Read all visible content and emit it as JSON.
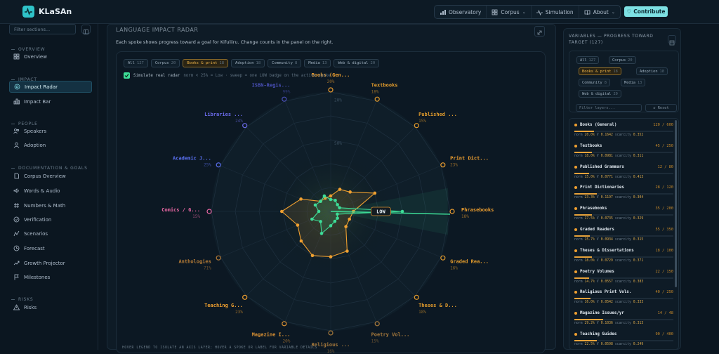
{
  "app": {
    "name": "KLaSAn"
  },
  "nav": {
    "items": [
      {
        "label": "Observatory",
        "icon": "chart-icon",
        "caret": false
      },
      {
        "label": "Corpus",
        "icon": "grid-icon",
        "caret": true
      },
      {
        "label": "Simulation",
        "icon": "pulse-icon",
        "caret": false
      },
      {
        "label": "About",
        "icon": "book-icon",
        "caret": true
      }
    ],
    "contribute": "Contribute"
  },
  "sidebar": {
    "filter_placeholder": "Filter sections...",
    "sections": [
      {
        "title": "OVERVIEW",
        "items": [
          {
            "label": "Overview",
            "icon": "grid-icon"
          }
        ]
      },
      {
        "title": "IMPACT",
        "items": [
          {
            "label": "Impact Radar",
            "icon": "radar-icon",
            "active": true
          },
          {
            "label": "Impact Bar",
            "icon": "bar-chart-icon"
          }
        ]
      },
      {
        "title": "PEOPLE",
        "items": [
          {
            "label": "Speakers",
            "icon": "users-icon"
          },
          {
            "label": "Adoption",
            "icon": "adoption-icon"
          }
        ]
      },
      {
        "title": "DOCUMENTATION & GOALS",
        "items": [
          {
            "label": "Corpus Overview",
            "icon": "document-icon"
          },
          {
            "label": "Words & Audio",
            "icon": "audio-icon"
          },
          {
            "label": "Numbers & Math",
            "icon": "hash-icon"
          },
          {
            "label": "Verification",
            "icon": "check-circle-icon"
          },
          {
            "label": "Scenarios",
            "icon": "scenarios-icon"
          },
          {
            "label": "Forecast",
            "icon": "forecast-icon"
          },
          {
            "label": "Growth Projector",
            "icon": "trend-icon"
          },
          {
            "label": "Milestones",
            "icon": "flag-icon"
          }
        ]
      },
      {
        "title": "RISKS",
        "items": [
          {
            "label": "Risks",
            "icon": "warning-icon"
          }
        ]
      }
    ]
  },
  "main": {
    "title": "LANGUAGE IMPACT RADAR",
    "subtitle": "Each spoke shows progress toward a goal for Kifuliiru. Change counts in the panel on the right.",
    "chips": [
      {
        "label": "All",
        "count": "127"
      },
      {
        "label": "Corpus",
        "count": "20"
      },
      {
        "label": "Books & print",
        "count": "18",
        "selected": true
      },
      {
        "label": "Adoption",
        "count": "18"
      },
      {
        "label": "Community",
        "count": "8"
      },
      {
        "label": "Media",
        "count": "13"
      },
      {
        "label": "Web & digital",
        "count": "20"
      }
    ],
    "simulate_label": "Simulate real radar",
    "simulate_note": "norm < 25% = Low · sweep = one LOW badge on the active spoke",
    "low_badge": "LOW",
    "footer_hint": "HOVER LEGEND TO ISOLATE AN AXIS LAYER; HOVER A SPOKE OR LABEL FOR VARIABLE DETAILS"
  },
  "chart_data": {
    "type": "radar",
    "spokes": [
      {
        "label": "Books (Gen...",
        "pct": "20%",
        "color": "#f0a030",
        "outer": 0.13,
        "inner": 0.1
      },
      {
        "label": "Textbooks",
        "pct": "18%",
        "color": "#e09a2c",
        "outer": 0.2,
        "inner": 0.1
      },
      {
        "label": "Published ...",
        "pct": "15%",
        "color": "#e09a2c",
        "outer": 0.23,
        "inner": 0.08
      },
      {
        "label": "Print Dict...",
        "pct": "23%",
        "color": "#f0a030",
        "outer": 0.4,
        "inner": 0.08
      },
      {
        "label": "Phrasebooks",
        "pct": "18%",
        "color": "#f0a030",
        "outer": 0.19,
        "inner": 0.6
      },
      {
        "label": "Graded Rea...",
        "pct": "16%",
        "color": "#e09a2c",
        "outer": 0.17,
        "inner": 0.06
      },
      {
        "label": "Theses & D...",
        "pct": "18%",
        "color": "#e09a2c",
        "outer": 0.18,
        "inner": 0.08
      },
      {
        "label": "Poetry Vol...",
        "pct": "15%",
        "color": "#a87a3c",
        "outer": 0.36,
        "inner": 0.09
      },
      {
        "label": "Religious ...",
        "pct": "16%",
        "color": "#a87a3c",
        "outer": 0.38,
        "inner": 0.12
      },
      {
        "label": "Magazine I...",
        "pct": "20%",
        "color": "#d99033",
        "outer": 0.4,
        "inner": 0.2
      },
      {
        "label": "Teaching G...",
        "pct": "23%",
        "color": "#f0a030",
        "outer": 0.35,
        "inner": 0.12
      },
      {
        "label": "Anthologies",
        "pct": "71%",
        "color": "#b37a36",
        "outer": 0.3,
        "inner": 0.17
      },
      {
        "label": "Comics / G...",
        "pct": "15%",
        "color": "#f06aa8",
        "outer": 0.41,
        "inner": 0.1
      },
      {
        "label": "Academic J...",
        "pct": "25%",
        "color": "#5a70f0",
        "outer": 0.27,
        "inner": 0.14
      },
      {
        "label": "Libraries ...",
        "pct": "24%",
        "color": "#6a6ae8",
        "outer": 0.12,
        "inner": 0.12
      },
      {
        "label": "ISBN-Regis...",
        "pct": "99%",
        "color": "#4a50b8",
        "outer": 0.12,
        "inner": 0.14
      }
    ],
    "ring_labels": [
      "20%",
      "50%"
    ],
    "active_spoke": 4
  },
  "right_panel": {
    "title": "VARIABLES — PROGRESS TOWARD TARGET (127)",
    "chips": [
      {
        "label": "All",
        "count": "127"
      },
      {
        "label": "Corpus",
        "count": "20"
      },
      {
        "label": "Books & print",
        "count": "18",
        "selected": true
      },
      {
        "label": "Adoption",
        "count": "18"
      },
      {
        "label": "Community",
        "count": "8"
      },
      {
        "label": "Media",
        "count": "13"
      },
      {
        "label": "Web & digital",
        "count": "20"
      }
    ],
    "filter_placeholder": "Filter layers...",
    "reset_label": "↺ Reset",
    "variables": [
      {
        "name": "Books (General)",
        "count": "120 / 600",
        "norm": "20.0%",
        "v": "0.1642",
        "scarcity": "0.352",
        "fill": 0.2
      },
      {
        "name": "Textbooks",
        "count": "45 / 250",
        "norm": "18.0%",
        "v": "0.0981",
        "scarcity": "0.311",
        "fill": 0.18
      },
      {
        "name": "Published Grammars",
        "count": "12 / 80",
        "norm": "15.0%",
        "v": "0.0771",
        "scarcity": "0.413",
        "fill": 0.15
      },
      {
        "name": "Print Dictionaries",
        "count": "28 / 120",
        "norm": "23.3%",
        "v": "0.1197",
        "scarcity": "0.304",
        "fill": 0.23
      },
      {
        "name": "Phrasebooks",
        "count": "35 / 200",
        "norm": "17.5%",
        "v": "0.0735",
        "scarcity": "0.329",
        "fill": 0.175
      },
      {
        "name": "Graded Readers",
        "count": "55 / 350",
        "norm": "15.7%",
        "v": "0.0934",
        "scarcity": "0.315",
        "fill": 0.157
      },
      {
        "name": "Theses & Dissertations",
        "count": "18 / 100",
        "norm": "18.0%",
        "v": "0.0729",
        "scarcity": "0.371",
        "fill": 0.18
      },
      {
        "name": "Poetry Volumes",
        "count": "22 / 150",
        "norm": "14.7%",
        "v": "0.0557",
        "scarcity": "0.383",
        "fill": 0.147
      },
      {
        "name": "Religious Print Vols.",
        "count": "40 / 250",
        "norm": "16.0%",
        "v": "0.0542",
        "scarcity": "0.333",
        "fill": 0.16
      },
      {
        "name": "Magazine Issues/yr",
        "count": "14 / 48",
        "norm": "29.2%",
        "v": "0.1036",
        "scarcity": "0.313",
        "fill": 0.29
      },
      {
        "name": "Teaching Guides",
        "count": "90 / 400",
        "norm": "22.5%",
        "v": "0.0598",
        "scarcity": "0.249",
        "fill": 0.225
      }
    ]
  }
}
